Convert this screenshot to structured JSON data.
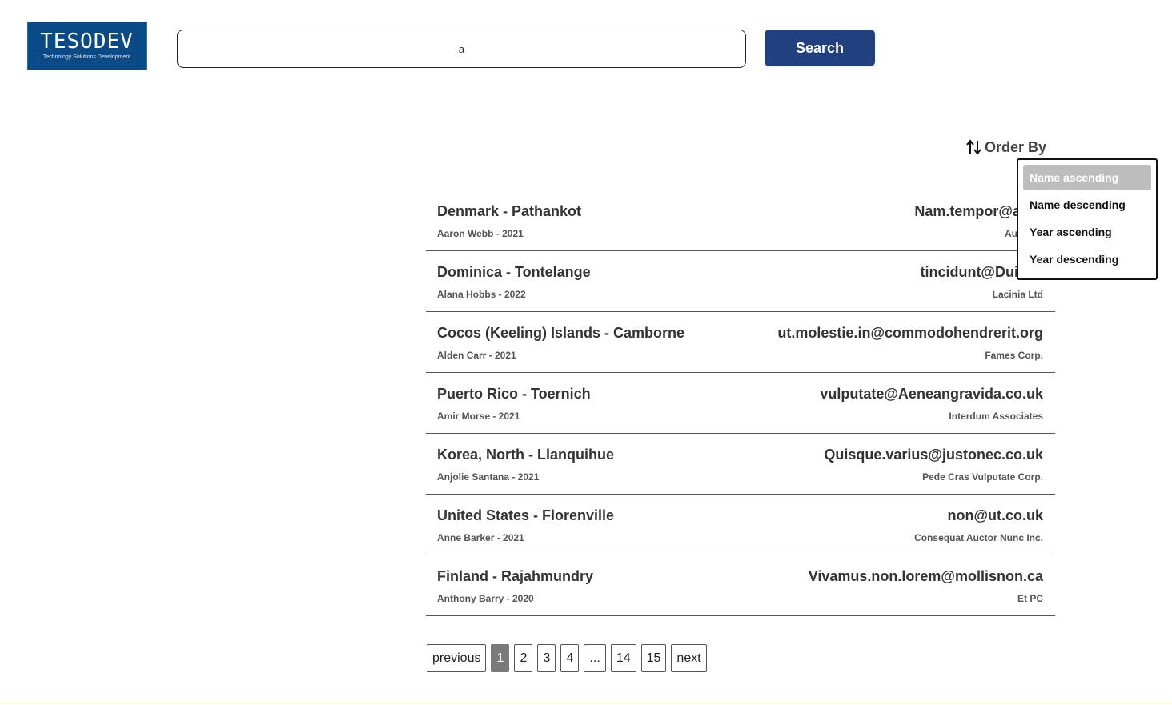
{
  "logo": {
    "text": "TESODEV",
    "subtext": "Technology Solutions Development"
  },
  "search": {
    "value": "a",
    "placeholder": "",
    "button_label": "Search"
  },
  "order_by": {
    "label": "Order By",
    "options": [
      "Name ascending",
      "Name descending",
      "Year ascending",
      "Year descending"
    ],
    "selected": "Name ascending"
  },
  "results": [
    {
      "title": "Denmark - Pathankot",
      "subtitle": "Aaron Webb - 2021",
      "email": "Nam.tempor@arcu",
      "company": "Augue L"
    },
    {
      "title": "Dominica - Tontelange",
      "subtitle": "Alana Hobbs - 2022",
      "email": "tincidunt@Duismi",
      "company": "Lacinia Ltd"
    },
    {
      "title": "Cocos (Keeling) Islands - Camborne",
      "subtitle": "Alden Carr - 2021",
      "email": "ut.molestie.in@commodohendrerit.org",
      "company": "Fames Corp."
    },
    {
      "title": "Puerto Rico - Toernich",
      "subtitle": "Amir Morse - 2021",
      "email": "vulputate@Aeneangravida.co.uk",
      "company": "Interdum Associates"
    },
    {
      "title": "Korea, North - Llanquihue",
      "subtitle": "Anjolie Santana - 2021",
      "email": "Quisque.varius@justonec.co.uk",
      "company": "Pede Cras Vulputate Corp."
    },
    {
      "title": "United States - Florenville",
      "subtitle": "Anne Barker - 2021",
      "email": "non@ut.co.uk",
      "company": "Consequat Auctor Nunc Inc."
    },
    {
      "title": "Finland - Rajahmundry",
      "subtitle": "Anthony Barry - 2020",
      "email": "Vivamus.non.lorem@mollisnon.ca",
      "company": "Et PC"
    }
  ],
  "pagination": {
    "previous": "previous",
    "pages": [
      "1",
      "2",
      "3",
      "4",
      "...",
      "14",
      "15"
    ],
    "current": "1",
    "next": "next"
  },
  "colors": {
    "brand": "#0a4a86",
    "search_button": "#204080",
    "selected_option": "#bdbdbd",
    "active_page": "#7a7a7a"
  }
}
